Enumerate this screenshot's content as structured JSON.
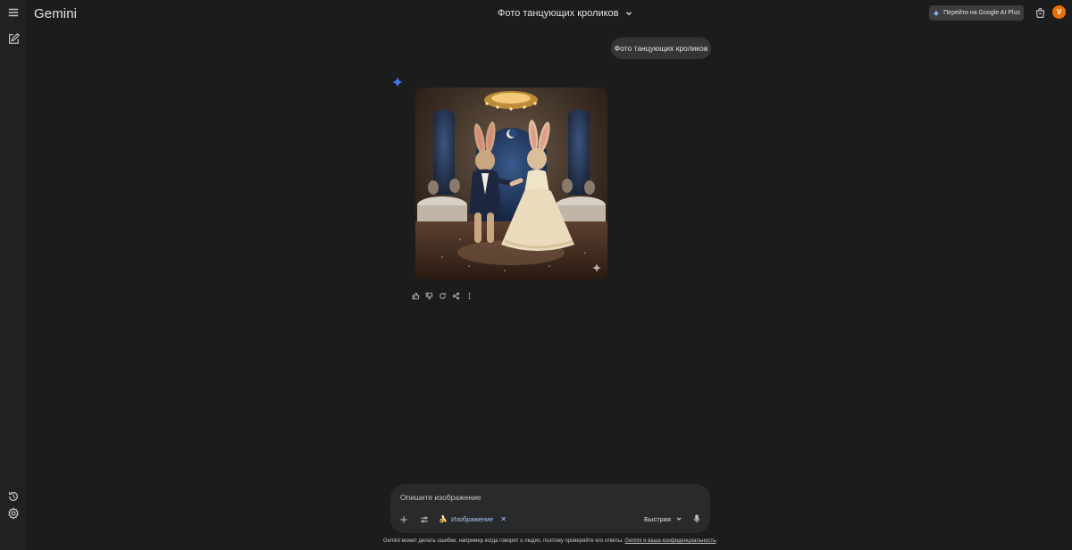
{
  "app": {
    "name": "Gemini"
  },
  "header": {
    "chat_title": "Фото танцующих кроликов",
    "upgrade_label": "Перейти на Google AI Plus",
    "avatar_letter": "V",
    "avatar_color": "#e8710a"
  },
  "sidebar": {
    "icons": [
      "menu-icon",
      "new-chat-icon",
      "activity-icon",
      "settings-icon"
    ]
  },
  "conversation": {
    "user_message": "Фото танцующих кроликов",
    "response_image_alt": "dancing-rabbits-image",
    "response_actions": [
      "thumb-up-icon",
      "thumb-down-icon",
      "regenerate-icon",
      "share-icon",
      "more-icon"
    ]
  },
  "composer": {
    "placeholder": "Опишите изображение",
    "tool_chip_emoji": "🍌",
    "tool_chip_label": "Изображение",
    "mode_label": "Быстрая"
  },
  "footer": {
    "disclaimer_text": "Gemini может делать ошибки, например когда говорит о людях, поэтому проверяйте его ответы.",
    "privacy_link": "Gemini и ваша конфиденциальность",
    "period": "."
  },
  "colors": {
    "background": "#1b1c1d",
    "accent": "#a8c7fa",
    "gemini_blue": "#4285f4"
  }
}
